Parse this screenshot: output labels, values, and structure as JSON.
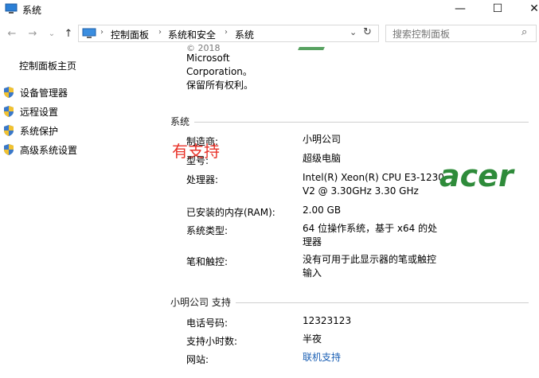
{
  "window": {
    "title": "系统",
    "controls": {
      "minimize": "—",
      "maximize": "☐",
      "close": "✕"
    }
  },
  "nav": {
    "back": "←",
    "forward": "→",
    "recent": "⌄",
    "up": "↑",
    "breadcrumbs": [
      "控制面板",
      "系统和安全",
      "系统"
    ],
    "separator": "›",
    "refresh": "↻",
    "dropdown": "⌄",
    "search_placeholder": "搜索控制面板"
  },
  "left_pane": {
    "home": "控制面板主页",
    "tasks": [
      {
        "label": "设备管理器",
        "icon": "shield-icon"
      },
      {
        "label": "远程设置",
        "icon": "shield-icon"
      },
      {
        "label": "系统保护",
        "icon": "shield-icon"
      },
      {
        "label": "高级系统设置",
        "icon": "shield-icon"
      }
    ]
  },
  "main": {
    "copyright": {
      "line0": "© 2018",
      "line1": "Microsoft",
      "line2": "Corporation。",
      "line3": "保留所有权利。"
    },
    "overlay_text": "有支持",
    "system_section": {
      "header": "系统",
      "rows": [
        {
          "label": "制造商:",
          "value": "小明公司"
        },
        {
          "label": "型号:",
          "value": "超级电脑"
        },
        {
          "label": "处理器:",
          "value": "Intel(R) Xeon(R) CPU E3-1230",
          "value2": "V2 @ 3.30GHz   3.30 GHz"
        },
        {
          "label": "已安装的内存(RAM):",
          "value": "2.00 GB"
        },
        {
          "label": "系统类型:",
          "value": "64 位操作系统，基于 x64 的处",
          "value2": "理器"
        },
        {
          "label": "笔和触控:",
          "value": "没有可用于此显示器的笔或触控",
          "value2": "输入"
        }
      ]
    },
    "support_section": {
      "header": "小明公司 支持",
      "rows": [
        {
          "label": "电话号码:",
          "value": "12323123"
        },
        {
          "label": "支持小时数:",
          "value": "半夜"
        },
        {
          "label": "网站:",
          "value": "联机支持"
        }
      ]
    },
    "oem_logo": "acer",
    "colors": {
      "link": "#1a5fb4",
      "overlay": "#e8332a",
      "logo": "#2e8b3a"
    }
  }
}
